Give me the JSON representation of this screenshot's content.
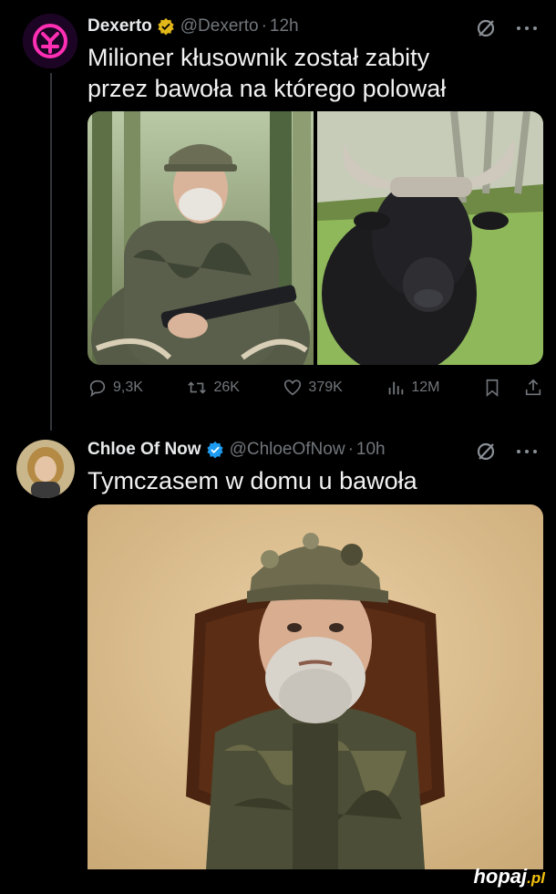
{
  "tweets": [
    {
      "author": "Dexerto",
      "handle": "@Dexerto",
      "time": "12h",
      "text_line1": "Milioner kłusownik został zabity",
      "text_line2": "przez bawoła na którego polował",
      "stats": {
        "replies": "9,3K",
        "reposts": "26K",
        "likes": "379K",
        "views": "12M"
      },
      "verified_color": "#e2b719"
    },
    {
      "author": "Chloe Of Now",
      "handle": "@ChloeOfNow",
      "time": "10h",
      "text": "Tymczasem w domu u bawoła",
      "verified_color": "#1d9bf0"
    }
  ],
  "separator": "·",
  "watermark": {
    "main": "hopaj",
    "suffix": ".pl"
  },
  "icons": {
    "grok": "slashed-circle-icon",
    "more": "more-dots-icon",
    "reply": "reply-icon",
    "repost": "repost-icon",
    "like": "heart-icon",
    "views": "views-icon",
    "bookmark": "bookmark-icon",
    "share": "share-icon"
  },
  "colors": {
    "background": "#000000",
    "text": "#e7e9ea",
    "muted": "#71767b",
    "verified_blue": "#1d9bf0",
    "verified_gold": "#e2b719"
  }
}
